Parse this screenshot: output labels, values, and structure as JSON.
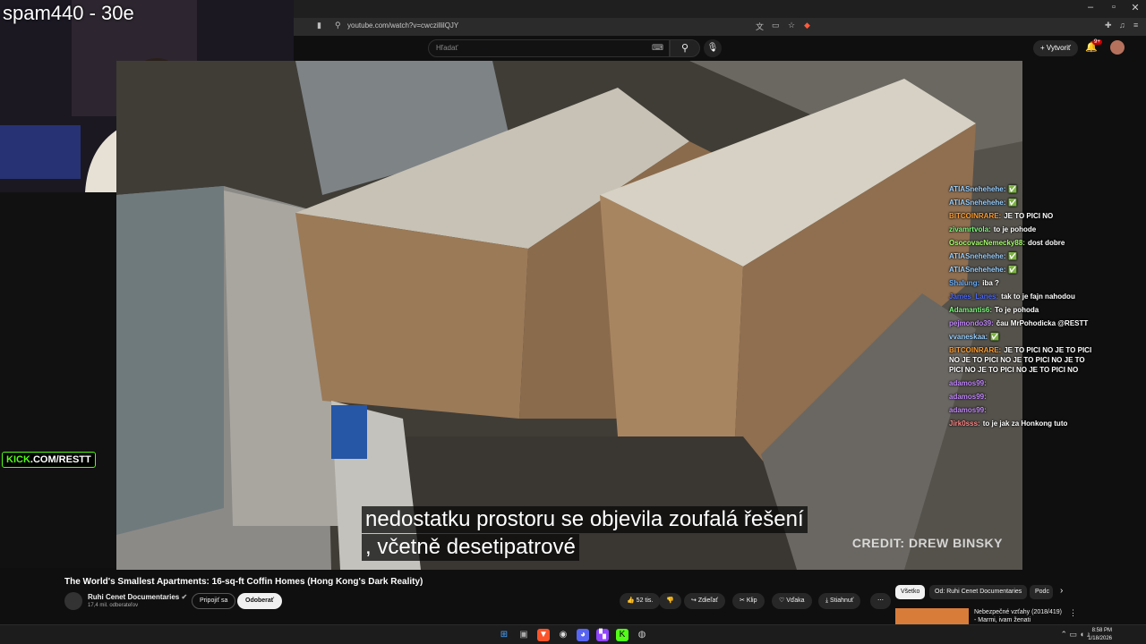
{
  "overlay": {
    "stream_title": "spam440 - 30e",
    "kick_prefix": "KICK",
    "kick_rest": ".COM/RESTT"
  },
  "browser": {
    "url": "youtube.com/watch?v=cwczillilQJY",
    "min": "–",
    "max": "▫",
    "close": "✕"
  },
  "youtube": {
    "search_placeholder": "Hľadať",
    "create_label": "Vytvoriť",
    "notif_count": "9+"
  },
  "video": {
    "subtitle_line1": "nedostatku prostoru se objevila zoufalá řešení",
    "subtitle_line2": ", včetně desetipatrové",
    "credit": "CREDIT: DREW BINSKY",
    "title": "The World's Smallest Apartments: 16-sq-ft Coffin Homes (Hong Kong's Dark Reality)",
    "channel": "Ruhi Cenet Documentaries",
    "subscribers": "17,4 mil. odberateľov",
    "join_label": "Pripojiť sa",
    "subscribe_label": "Odoberať",
    "likes": "52 tis.",
    "share_label": "Zdieľať",
    "clip_label": "Klip",
    "thanks_label": "Vďaka",
    "download_label": "Stiahnuť"
  },
  "chips": [
    {
      "label": "Všetko"
    },
    {
      "label": "Od: Ruhi Cenet Documentaries"
    },
    {
      "label": "Podc"
    }
  ],
  "recommendation": {
    "title1": "Nebezpečné vzťahy (2018/419)",
    "title2": "- Marmi, ivam ženati"
  },
  "chat": [
    {
      "user": "ATIASnehehehe:",
      "text": "✅",
      "color": "#9ad0ff"
    },
    {
      "user": "ATIASnehehehe:",
      "text": "✅",
      "color": "#9ad0ff"
    },
    {
      "user": "BITCOINRARE:",
      "text": "JE TO PICI NO",
      "color": "#ff9d2e"
    },
    {
      "user": "zivamrtvola:",
      "text": "to je pohode",
      "color": "#7cfc7c"
    },
    {
      "user": "OsocovacNemecky88:",
      "text": "dost dobre",
      "color": "#a8ff70"
    },
    {
      "user": "ATIASnehehehe:",
      "text": "✅",
      "color": "#9ad0ff"
    },
    {
      "user": "ATIASnehehehe:",
      "text": "✅",
      "color": "#9ad0ff"
    },
    {
      "user": "Shalung:",
      "text": "iba ?",
      "color": "#6ab0ff"
    },
    {
      "user": "James_Lanes:",
      "text": "tak to je fajn nahodou",
      "color": "#4d6bff"
    },
    {
      "user": "Adamantis6:",
      "text": "To je pohoda",
      "color": "#7cfc7c"
    },
    {
      "user": "pejmondo39:",
      "text": "čau MrPohodicka @RESTT",
      "color": "#c58bff"
    },
    {
      "user": "vvaneskaa:",
      "text": "✅",
      "color": "#9ad0ff"
    },
    {
      "user": "BITCOINRARE:",
      "text": "JE TO PICI NO JE TO PICI NO JE TO PICI NO JE TO PICI NO JE TO PICI NO JE TO PICI NO JE TO PICI NO",
      "color": "#ff9d2e"
    },
    {
      "user": "adamos99:",
      "text": "",
      "color": "#c58bff"
    },
    {
      "user": "adamos99:",
      "text": "",
      "color": "#c58bff"
    },
    {
      "user": "adamos99:",
      "text": "",
      "color": "#c58bff"
    },
    {
      "user": "Jirk0sss:",
      "text": "to je jak za Honkong tuto",
      "color": "#ff8a8a"
    }
  ],
  "taskbar": {
    "time": "8:58 PM",
    "date": "1/18/2026"
  }
}
